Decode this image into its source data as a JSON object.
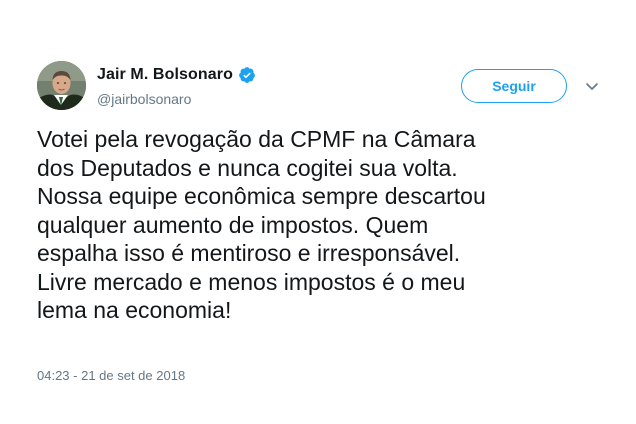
{
  "author": {
    "display_name": "Jair M. Bolsonaro",
    "handle": "@jairbolsonaro",
    "verified": true,
    "avatar_icon": "profile-photo"
  },
  "follow_button": {
    "label": "Seguir"
  },
  "more_menu_icon": "chevron-down-icon",
  "tweet": {
    "lines": [
      "Votei pela revogação da CPMF na Câmara",
      "dos Deputados e nunca cogitei sua volta.",
      "Nossa equipe econômica sempre descartou",
      "qualquer aumento de impostos. Quem",
      "espalha isso é mentiroso e irresponsável.",
      "Livre mercado e menos impostos é o meu",
      "lema na economia!"
    ],
    "timestamp": "04:23 - 21 de set de 2018"
  },
  "colors": {
    "accent": "#1da1f2",
    "text_primary": "#14171a",
    "text_secondary": "#657786"
  }
}
